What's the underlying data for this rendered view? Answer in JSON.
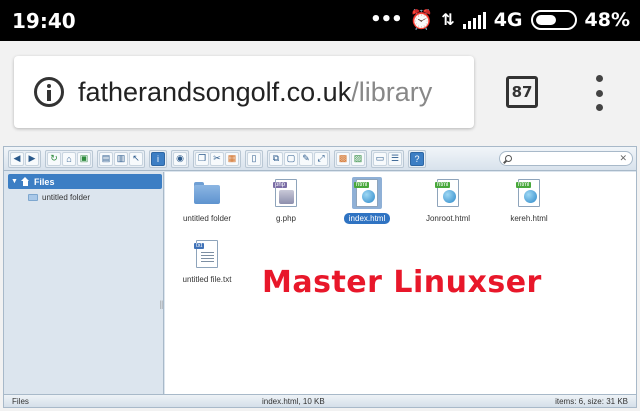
{
  "status_bar": {
    "time": "19:40",
    "dots": "•••",
    "network": "4G",
    "battery": "48%"
  },
  "browser": {
    "url_host": "fatherandsongolf.co.uk",
    "url_path": "/library",
    "tab_count": "87"
  },
  "file_manager": {
    "sidebar": {
      "root_label": "Files",
      "children": [
        "untitled folder"
      ]
    },
    "files": [
      {
        "name": "untitled folder",
        "type": "folder",
        "tag": ""
      },
      {
        "name": "g.php",
        "type": "php",
        "tag": "php"
      },
      {
        "name": "index.html",
        "type": "html",
        "tag": "html",
        "selected": true
      },
      {
        "name": "Jonroot.html",
        "type": "html",
        "tag": "html"
      },
      {
        "name": "kereh.html",
        "type": "html",
        "tag": "html"
      },
      {
        "name": "untitled file.txt",
        "type": "txt",
        "tag": "txt"
      }
    ],
    "status": {
      "left": "Files",
      "middle": "index.html, 10 KB",
      "right": "items: 6, size: 31 KB"
    }
  },
  "watermark": "Master Linuxser",
  "colors": {
    "selection": "#2f73c2",
    "watermark": "#e8172a"
  }
}
